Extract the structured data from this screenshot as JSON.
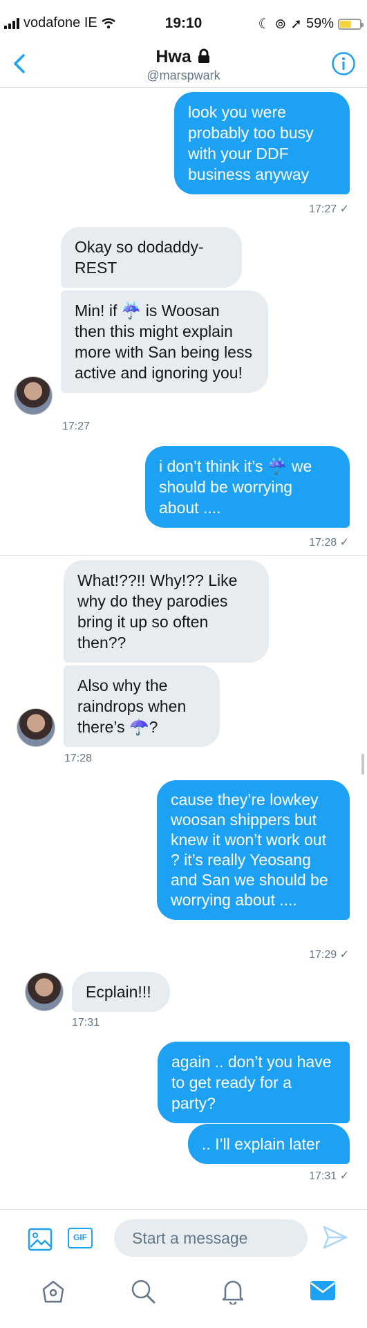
{
  "status_bar": {
    "carrier": "vodafone IE",
    "time": "19:10",
    "battery": "59%",
    "battery_level": 0.59
  },
  "header": {
    "name": "Hwa",
    "handle": "@marspwark"
  },
  "messages": [
    {
      "dir": "out",
      "text": "look you were probably too busy with your DDF business anyway",
      "time": "17:27 ✓"
    },
    {
      "dir": "in",
      "text": "Okay so dodaddy-REST"
    },
    {
      "dir": "in",
      "text_before": "Min! if",
      "emoji": "☔",
      "text_after": "is Woosan then this might explain more with San being less active and ignoring you!",
      "time": "17:27"
    },
    {
      "dir": "out",
      "text_before": "i don’t think it’s",
      "emoji": "☔",
      "text_after": "we should be worrying about ....",
      "time": "17:28 ✓"
    },
    {
      "dir": "in",
      "text": "What!??!! Why!?? Like why do they parodies bring it up so often then??"
    },
    {
      "dir": "in",
      "text_before": "Also why the raindrops when there’s",
      "emoji": "☂️",
      "text_after": "?",
      "time": "17:28"
    },
    {
      "dir": "out",
      "text": "cause they’re lowkey woosan shippers but knew it won’t work out ? it’s really Yeosang and San we should be worrying about ....",
      "time": "17:29 ✓"
    },
    {
      "dir": "in",
      "text": "Ecplain!!!",
      "time": "17:31"
    },
    {
      "dir": "out",
      "text": "again .. don’t you have to get ready for a party?"
    },
    {
      "dir": "out",
      "text": ".. I’ll explain later",
      "time": "17:31 ✓"
    }
  ],
  "composer": {
    "placeholder": "Start a message",
    "gif_label": "GIF"
  },
  "colors": {
    "accent": "#1da1f2",
    "incoming": "#e6ecf0",
    "muted": "#657786"
  }
}
